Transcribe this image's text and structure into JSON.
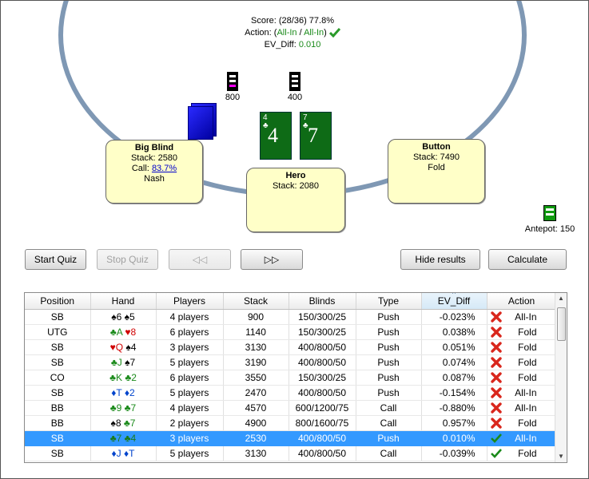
{
  "score": {
    "label": "Score:",
    "value": "(28/36) 77.8%"
  },
  "action": {
    "label": "Action:",
    "open": "(",
    "a1": "All-In",
    "sep": " / ",
    "a2": "All-In",
    "close": ")"
  },
  "ev": {
    "label": "EV_Diff:",
    "value": "0.010"
  },
  "seats": {
    "bb": {
      "name": "Big Blind",
      "stack": "Stack: 2580",
      "call_label": "Call:",
      "call_value": "83.7%",
      "strategy": "Nash"
    },
    "hero": {
      "name": "Hero",
      "stack": "Stack: 2080"
    },
    "btn": {
      "name": "Button",
      "stack": "Stack: 7490",
      "action": "Fold"
    }
  },
  "bets": {
    "bb": "800",
    "sb": "400"
  },
  "antepot": "Antepot: 150",
  "cards": [
    {
      "rank": "4",
      "suit": "♣"
    },
    {
      "rank": "7",
      "suit": "♣"
    }
  ],
  "buttons": {
    "start": "Start Quiz",
    "stop": "Stop Quiz",
    "prev": "◁◁",
    "next": "▷▷",
    "hide": "Hide results",
    "calc": "Calculate"
  },
  "grid": {
    "headers": [
      "Position",
      "Hand",
      "Players",
      "Stack",
      "Blinds",
      "Type",
      "EV_Diff",
      "Action"
    ],
    "sort_indicator": "^",
    "rows": [
      {
        "pos": "SB",
        "hand": [
          [
            "♠",
            "6",
            "s"
          ],
          [
            "♠",
            "5",
            "s"
          ]
        ],
        "players": "4 players",
        "stack": "900",
        "blinds": "150/300/25",
        "type": "Push",
        "ev": "-0.023%",
        "ok": false,
        "action": "All-In"
      },
      {
        "pos": "UTG",
        "hand": [
          [
            "♣",
            "A",
            "c"
          ],
          [
            "♥",
            "8",
            "h"
          ]
        ],
        "players": "6 players",
        "stack": "1140",
        "blinds": "150/300/25",
        "type": "Push",
        "ev": "0.038%",
        "ok": false,
        "action": "Fold"
      },
      {
        "pos": "SB",
        "hand": [
          [
            "♥",
            "Q",
            "h"
          ],
          [
            "♠",
            "4",
            "s"
          ]
        ],
        "players": "3 players",
        "stack": "3130",
        "blinds": "400/800/50",
        "type": "Push",
        "ev": "0.051%",
        "ok": false,
        "action": "Fold"
      },
      {
        "pos": "SB",
        "hand": [
          [
            "♣",
            "J",
            "c"
          ],
          [
            "♠",
            "7",
            "s"
          ]
        ],
        "players": "5 players",
        "stack": "3190",
        "blinds": "400/800/50",
        "type": "Push",
        "ev": "0.074%",
        "ok": false,
        "action": "Fold"
      },
      {
        "pos": "CO",
        "hand": [
          [
            "♣",
            "K",
            "c"
          ],
          [
            "♣",
            "2",
            "c"
          ]
        ],
        "players": "6 players",
        "stack": "3550",
        "blinds": "150/300/25",
        "type": "Push",
        "ev": "0.087%",
        "ok": false,
        "action": "Fold"
      },
      {
        "pos": "SB",
        "hand": [
          [
            "♦",
            "T",
            "d"
          ],
          [
            "♦",
            "2",
            "d"
          ]
        ],
        "players": "5 players",
        "stack": "2470",
        "blinds": "400/800/50",
        "type": "Push",
        "ev": "-0.154%",
        "ok": false,
        "action": "All-In"
      },
      {
        "pos": "BB",
        "hand": [
          [
            "♣",
            "9",
            "c"
          ],
          [
            "♣",
            "7",
            "c"
          ]
        ],
        "players": "4 players",
        "stack": "4570",
        "blinds": "600/1200/75",
        "type": "Call",
        "ev": "-0.880%",
        "ok": false,
        "action": "All-In"
      },
      {
        "pos": "BB",
        "hand": [
          [
            "♠",
            "8",
            "s"
          ],
          [
            "♣",
            "7",
            "c"
          ]
        ],
        "players": "2 players",
        "stack": "4900",
        "blinds": "800/1600/75",
        "type": "Call",
        "ev": "0.957%",
        "ok": false,
        "action": "Fold"
      },
      {
        "pos": "SB",
        "hand": [
          [
            "♣",
            "7",
            "c"
          ],
          [
            "♣",
            "4",
            "c"
          ]
        ],
        "players": "3 players",
        "stack": "2530",
        "blinds": "400/800/50",
        "type": "Push",
        "ev": "0.010%",
        "ok": true,
        "action": "All-In",
        "selected": true
      },
      {
        "pos": "SB",
        "hand": [
          [
            "♦",
            "J",
            "d"
          ],
          [
            "♦",
            "T",
            "d"
          ]
        ],
        "players": "5 players",
        "stack": "3130",
        "blinds": "400/800/50",
        "type": "Call",
        "ev": "-0.039%",
        "ok": true,
        "action": "Fold"
      }
    ]
  },
  "colors": {
    "accent_selected": "#3399ff",
    "ok_green": "#1a8a1a",
    "error_red": "#d9261c",
    "seat_bg": "#ffffc8",
    "felt_border": "#7f98b4"
  },
  "icons": {
    "error": "red-x-icon",
    "ok": "green-check-icon"
  }
}
